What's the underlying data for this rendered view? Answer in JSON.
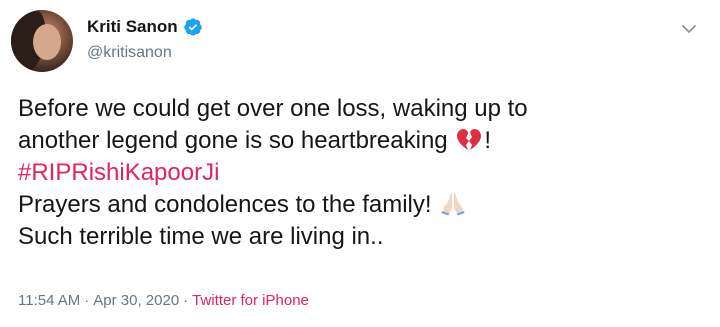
{
  "user": {
    "display_name": "Kriti Sanon",
    "handle": "@kritisanon",
    "verified_color": "#1da1f2"
  },
  "tweet": {
    "line1": "Before we could get over one loss, waking up to",
    "line2_text": "another legend gone is so heartbreaking",
    "line2_emoji": "broken-heart-icon",
    "line2_suffix": "!",
    "hashtag": "#RIPRishiKapoorJi",
    "line4_text": "Prayers and condolences to the family!",
    "line4_emoji": "folded-hands-icon",
    "line5": "Such terrible time we are living in.."
  },
  "meta": {
    "time": "11:54 AM",
    "separator": "·",
    "date": "Apr 30, 2020",
    "source": "Twitter for iPhone"
  },
  "colors": {
    "accent": "#e0245e",
    "text": "#14171a",
    "muted": "#657786"
  }
}
